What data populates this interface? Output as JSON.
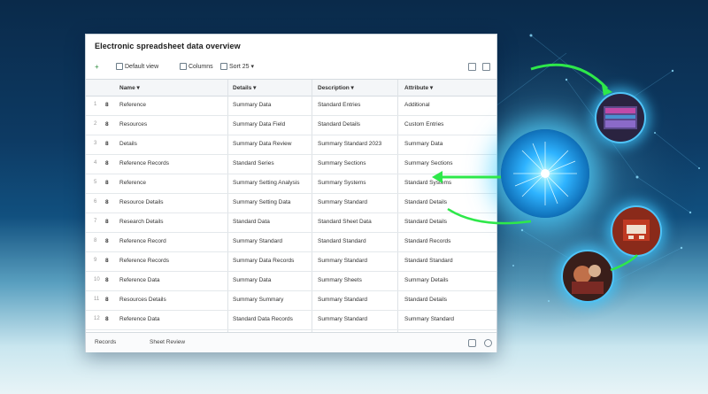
{
  "window": {
    "title": "Electronic spreadsheet data overview",
    "toolbar": [
      {
        "label": "Default view"
      },
      {
        "label": "Columns"
      },
      {
        "label": "Sort 25 ▾"
      }
    ]
  },
  "table": {
    "columns": [
      "Name ▾",
      "Details ▾",
      "Description ▾",
      "Attribute ▾"
    ],
    "rows": [
      {
        "num": "1",
        "flag": "8",
        "cells": [
          "Reference",
          "Summary Data",
          "Standard Entries",
          "Additional"
        ]
      },
      {
        "num": "2",
        "flag": "8",
        "cells": [
          "Resources",
          "Summary Data Field",
          "Standard Details",
          "Custom Entries"
        ]
      },
      {
        "num": "3",
        "flag": "8",
        "cells": [
          "Details",
          "Summary Data Review",
          "Summary Standard 2023",
          "Summary Data"
        ]
      },
      {
        "num": "4",
        "flag": "8",
        "cells": [
          "Reference Records",
          "Standard Series",
          "Summary Sections",
          "Summary Sections"
        ]
      },
      {
        "num": "5",
        "flag": "8",
        "cells": [
          "Reference",
          "Summary Setting Analysis",
          "Summary Systems",
          "Standard Systems"
        ]
      },
      {
        "num": "6",
        "flag": "8",
        "cells": [
          "Resource Details",
          "Summary Setting Data",
          "Summary Standard",
          "Standard Details"
        ]
      },
      {
        "num": "7",
        "flag": "8",
        "cells": [
          "Research Details",
          "Standard Data",
          "Standard Sheet Data",
          "Standard Details"
        ]
      },
      {
        "num": "8",
        "flag": "8",
        "cells": [
          "Reference Record",
          "Summary Standard",
          "Standard Standard",
          "Standard Records"
        ]
      },
      {
        "num": "9",
        "flag": "8",
        "cells": [
          "Reference Records",
          "Summary Data Records",
          "Summary Standard",
          "Standard Standard"
        ]
      },
      {
        "num": "10",
        "flag": "8",
        "cells": [
          "Reference Data",
          "Summary Data",
          "Summary Sheets",
          "Summary Details"
        ]
      },
      {
        "num": "11",
        "flag": "8",
        "cells": [
          "Resources Details",
          "Summary Summary",
          "Summary Standard",
          "Standard Details"
        ]
      },
      {
        "num": "12",
        "flag": "8",
        "cells": [
          "Reference Data",
          "Standard Data Records",
          "Summary Standard",
          "Summary Standard"
        ]
      }
    ]
  },
  "footer": {
    "left": "Records",
    "middle": "Sheet Review"
  },
  "colors": {
    "accent_green": "#2ee84a",
    "glow_blue": "#4fc3f7"
  }
}
